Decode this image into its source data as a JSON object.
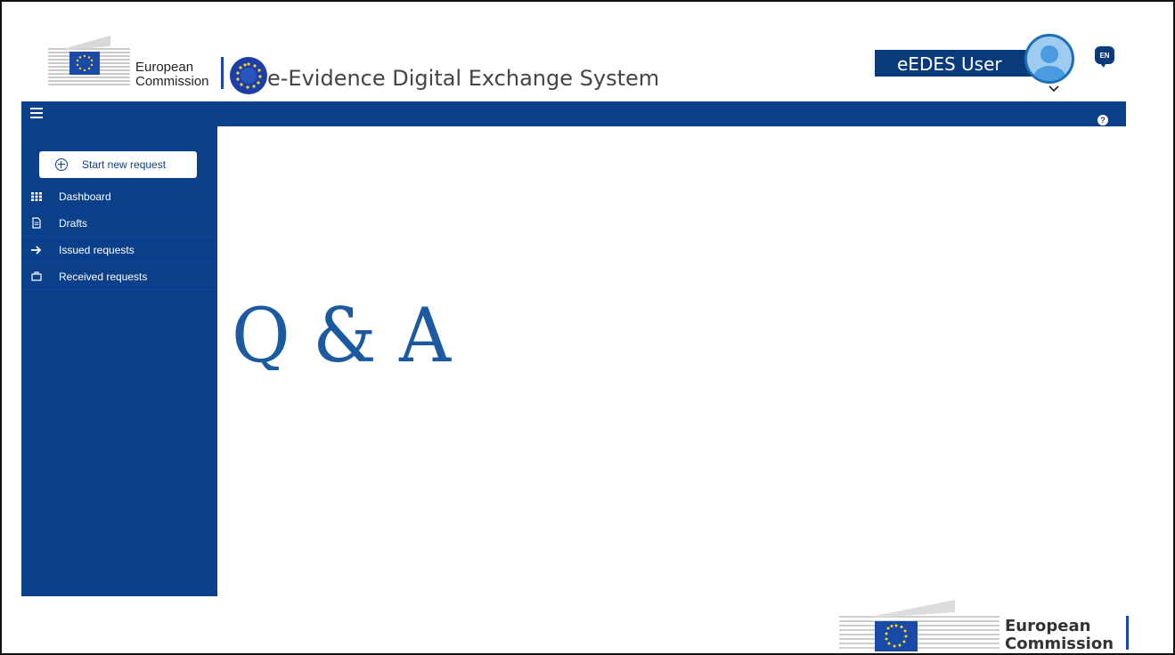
{
  "header": {
    "ec_line1": "European",
    "ec_line2": "Commission",
    "app_title": "e-Evidence Digital Exchange System",
    "user_label": "eEDES User",
    "language_code": "EN"
  },
  "sidebar": {
    "start_button": "Start new request",
    "items": [
      {
        "label": "Dashboard",
        "icon": "grid-icon"
      },
      {
        "label": "Drafts",
        "icon": "document-icon"
      },
      {
        "label": "Issued requests",
        "icon": "arrow-right-icon"
      },
      {
        "label": "Received requests",
        "icon": "inbox-icon"
      }
    ]
  },
  "content": {
    "qa_text": "Q & A"
  },
  "footer": {
    "ec_line1": "European",
    "ec_line2": "Commission"
  },
  "colors": {
    "primary_blue": "#0a3f8a",
    "avatar_blue": "#9ecbf0",
    "eu_flag_blue": "#1a4aa8",
    "eu_star_yellow": "#ffd617"
  }
}
